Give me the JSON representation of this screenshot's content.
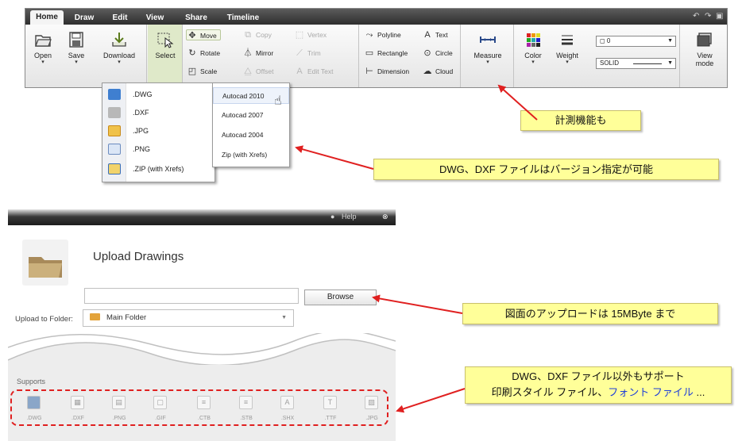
{
  "ribbon": {
    "tabs": [
      "Home",
      "Draw",
      "Edit",
      "View",
      "Share",
      "Timeline"
    ],
    "file": {
      "open": "Open",
      "save": "Save",
      "download": "Download"
    },
    "select": "Select",
    "modify": {
      "move": "Move",
      "rotate": "Rotate",
      "scale": "Scale",
      "copy": "Copy",
      "mirror": "Mirror",
      "offset": "Offset",
      "vertex": "Vertex",
      "trim": "Trim",
      "edit_text": "Edit Text"
    },
    "draw": {
      "polyline": "Polyline",
      "rectangle": "Rectangle",
      "dimension": "Dimension",
      "text": "Text",
      "circle": "Circle",
      "cloud": "Cloud"
    },
    "measure": "Measure",
    "color": "Color",
    "weight": "Weight",
    "layer_value": "0",
    "linetype_value": "SOLID",
    "view_mode": "View mode"
  },
  "download_menu": {
    "formats": [
      ".DWG",
      ".DXF",
      ".JPG",
      ".PNG",
      ".ZIP (with Xrefs)"
    ],
    "versions": [
      "Autocad 2010",
      "Autocad 2007",
      "Autocad 2004",
      "Zip (with Xrefs)"
    ]
  },
  "callouts": {
    "measure": "計測機能も",
    "versions": "DWG、DXF ファイルはバージョン指定が可能",
    "upload_limit": "図面のアップロードは 15MByte まで",
    "supports_line1": "DWG、DXF ファイル以外もサポート",
    "supports_line2_a": "印刷スタイル ファイル、",
    "supports_line2_b": "フォント ファイル",
    "supports_line2_c": " ..."
  },
  "upload": {
    "help": "Help",
    "title": "Upload Drawings",
    "browse": "Browse",
    "folder_label": "Upload to Folder:",
    "folder_value": "Main Folder",
    "supports_label": "Supports",
    "file_types": [
      ".DWG",
      ".DXF",
      ".PNG",
      ".GIF",
      ".CTB",
      ".STB",
      ".SHX",
      ".TTF",
      ".JPG"
    ]
  },
  "colors": {
    "arrow_red": "#e02020",
    "callout_bg": "#ffff99",
    "link_blue": "#1f3fd8"
  }
}
